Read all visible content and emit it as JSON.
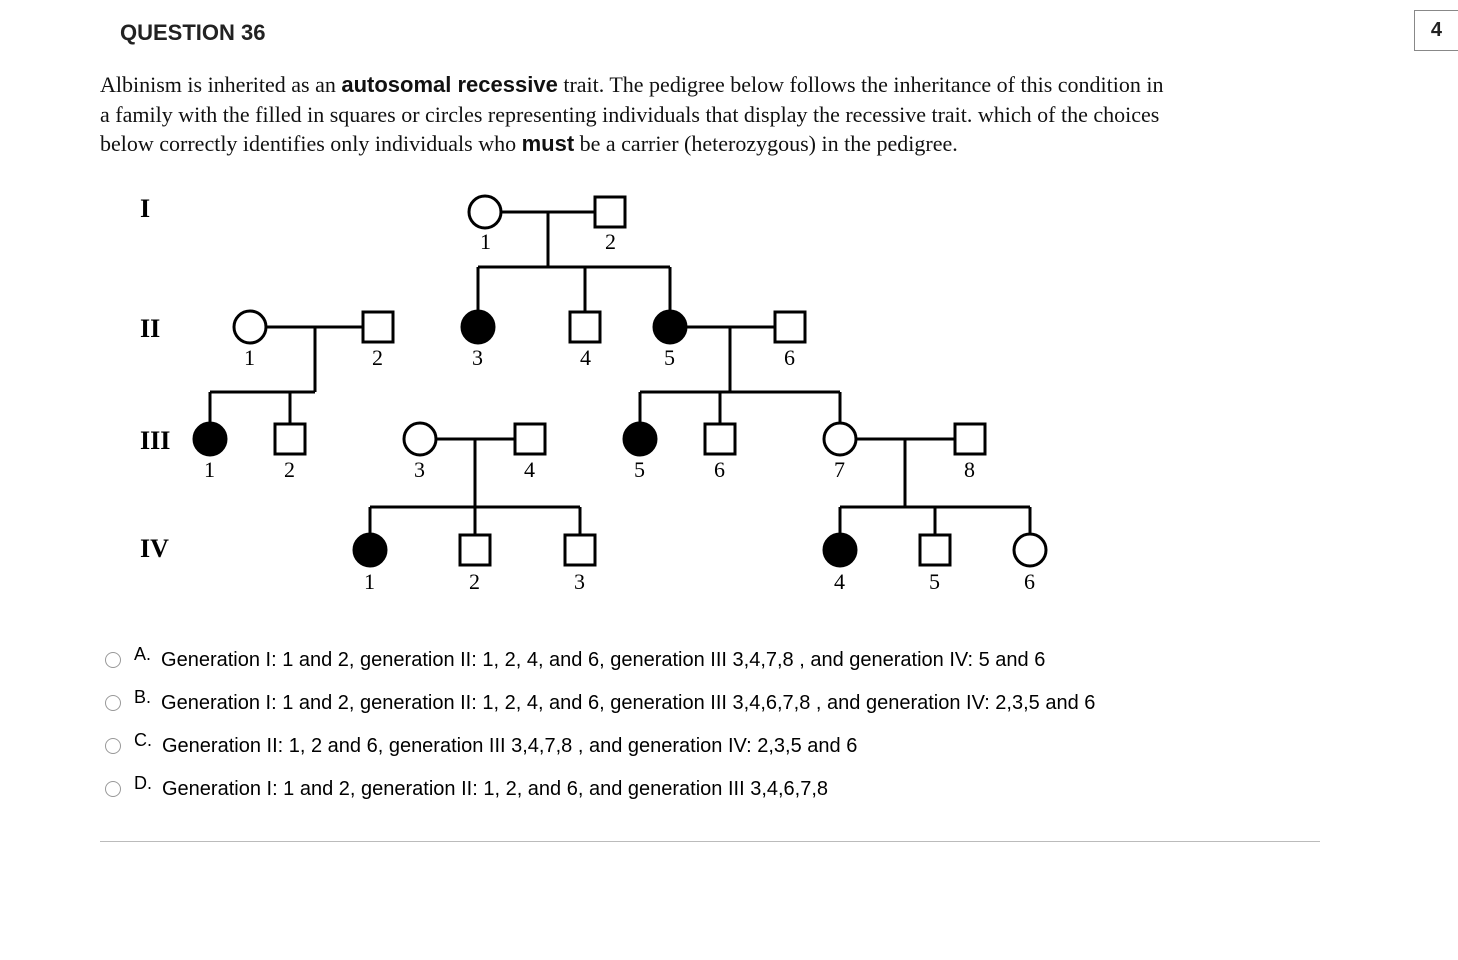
{
  "question_heading": "QUESTION 36",
  "points": "4",
  "stem_pre": "Albinism is inherited as an ",
  "stem_bold1": "autosomal recessive",
  "stem_mid": " trait.  The pedigree below follows the inheritance of this condition in a family with the filled in squares or circles representing individuals that display the recessive trait.  which of the choices below correctly identifies only individuals who ",
  "stem_bold2": "must",
  "stem_post": " be a carrier (heterozygous) in the pedigree.",
  "generations": {
    "g1": "I",
    "g2": "II",
    "g3": "III",
    "g4": "IV"
  },
  "nums": {
    "n1": "1",
    "n2": "2",
    "n3": "3",
    "n4": "4",
    "n5": "5",
    "n6": "6",
    "n7": "7",
    "n8": "8"
  },
  "choices": {
    "a_letter": "A.",
    "a_text": "Generation I: 1 and 2, generation II: 1, 2, 4, and 6,  generation III 3,4,7,8 , and generation IV: 5 and 6",
    "b_letter": "B.",
    "b_text": "Generation I: 1 and 2, generation II: 1, 2, 4, and 6,  generation III 3,4,6,7,8 , and generation IV: 2,3,5 and 6",
    "c_letter": "C.",
    "c_text": "Generation II: 1, 2 and 6,  generation III 3,4,7,8 , and generation IV: 2,3,5 and 6",
    "d_letter": "D.",
    "d_text": "Generation I: 1 and 2, generation II: 1, 2, and 6, and generation III 3,4,6,7,8"
  }
}
